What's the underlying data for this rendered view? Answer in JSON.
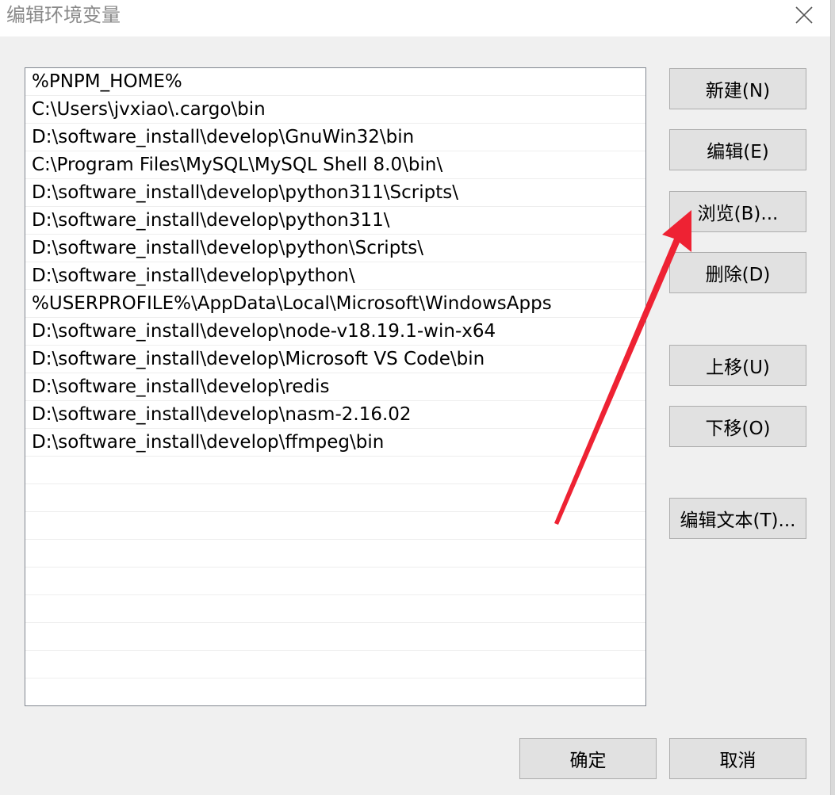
{
  "window": {
    "title": "编辑环境变量",
    "close_icon": "close-icon"
  },
  "path_list": {
    "items": [
      "%PNPM_HOME%",
      "C:\\Users\\jvxiao\\.cargo\\bin",
      "D:\\software_install\\develop\\GnuWin32\\bin",
      "C:\\Program Files\\MySQL\\MySQL Shell 8.0\\bin\\",
      "D:\\software_install\\develop\\python311\\Scripts\\",
      "D:\\software_install\\develop\\python311\\",
      "D:\\software_install\\develop\\python\\Scripts\\",
      "D:\\software_install\\develop\\python\\",
      "%USERPROFILE%\\AppData\\Local\\Microsoft\\WindowsApps",
      "D:\\software_install\\develop\\node-v18.19.1-win-x64",
      "D:\\software_install\\develop\\Microsoft VS Code\\bin",
      "D:\\software_install\\develop\\redis",
      "D:\\software_install\\develop\\nasm-2.16.02",
      "D:\\software_install\\develop\\ffmpeg\\bin",
      "",
      "",
      "",
      "",
      "",
      "",
      "",
      "",
      ""
    ]
  },
  "buttons": {
    "new": "新建(N)",
    "edit": "编辑(E)",
    "browse": "浏览(B)...",
    "delete": "删除(D)",
    "move_up": "上移(U)",
    "move_down": "下移(O)",
    "edit_text": "编辑文本(T)...",
    "ok": "确定",
    "cancel": "取消"
  },
  "annotation": {
    "arrow_color": "#ee2233",
    "arrow_icon": "red-arrow-pointing-to-browse"
  }
}
